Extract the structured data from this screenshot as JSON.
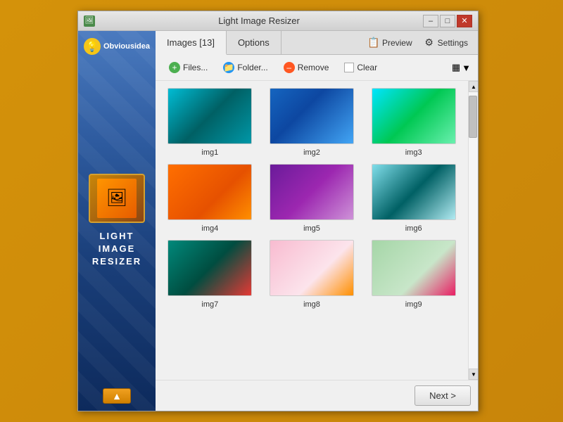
{
  "window": {
    "title": "Light Image Resizer",
    "icon": "🖼",
    "minimize_label": "–",
    "maximize_label": "□",
    "close_label": "✕"
  },
  "tabs": [
    {
      "id": "images",
      "label": "Images [13]",
      "active": true
    },
    {
      "id": "options",
      "label": "Options",
      "active": false
    }
  ],
  "tab_actions": [
    {
      "id": "preview",
      "icon": "📋",
      "label": "Preview"
    },
    {
      "id": "settings",
      "icon": "⚙",
      "label": "Settings"
    }
  ],
  "toolbar": {
    "files_label": "Files...",
    "folders_label": "Folder...",
    "remove_label": "Remove",
    "clear_label": "Clear"
  },
  "sidebar": {
    "logo_text": "Obviousidea",
    "product_name_line1": "LIGHT",
    "product_name_line2": "IMAGE",
    "product_name_line3": "RESIZER",
    "arrow_label": "▲"
  },
  "images": [
    {
      "id": 1,
      "label": "img1",
      "color_class": "img-teal-leaf"
    },
    {
      "id": 2,
      "label": "img2",
      "color_class": "img-blue-leaf"
    },
    {
      "id": 3,
      "label": "img3",
      "color_class": "img-green"
    },
    {
      "id": 4,
      "label": "img4",
      "color_class": "img-orange"
    },
    {
      "id": 5,
      "label": "img5",
      "color_class": "img-purple"
    },
    {
      "id": 6,
      "label": "img6",
      "color_class": "img-teal-glass"
    },
    {
      "id": 7,
      "label": "img7",
      "color_class": "img-flower-red"
    },
    {
      "id": 8,
      "label": "img8",
      "color_class": "img-flower-yellow"
    },
    {
      "id": 9,
      "label": "img9",
      "color_class": "img-flower-pink"
    }
  ],
  "bottom": {
    "next_label": "Next >"
  }
}
